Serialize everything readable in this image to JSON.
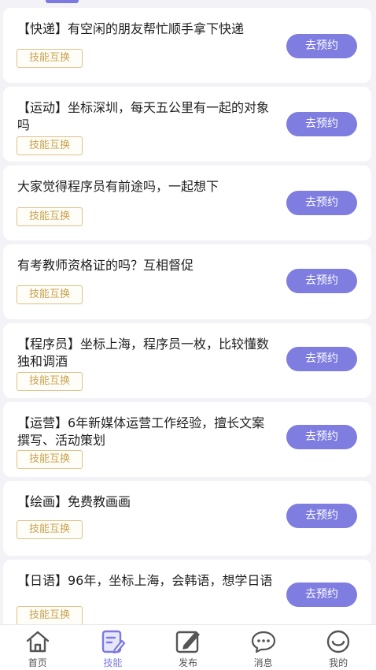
{
  "cards": [
    {
      "title": "【快递】有空闲的朋友帮忙顺手拿下快递",
      "tag": "技能互换",
      "button": "去预约"
    },
    {
      "title": "【运动】坐标深圳，每天五公里有一起的对象吗",
      "tag": "技能互换",
      "button": "去预约"
    },
    {
      "title": "大家觉得程序员有前途吗，一起想下",
      "tag": "技能互换",
      "button": "去预约"
    },
    {
      "title": "有考教师资格证的吗？互相督促",
      "tag": "技能互换",
      "button": "去预约"
    },
    {
      "title": "【程序员】坐标上海，程序员一枚，比较懂数独和调酒",
      "tag": "技能互换",
      "button": "去预约"
    },
    {
      "title": "【运营】6年新媒体运营工作经验，擅长文案撰写、活动策划",
      "tag": "技能互换",
      "button": "去预约"
    },
    {
      "title": "【绘画】免费教画画",
      "tag": "技能互换",
      "button": "去预约"
    },
    {
      "title": "【日语】96年，坐标上海，会韩语，想学日语",
      "tag": "技能互换",
      "button": "去预约"
    }
  ],
  "tabbar": {
    "items": [
      {
        "label": "首页",
        "icon": "home-icon"
      },
      {
        "label": "技能",
        "icon": "skill-edit-icon"
      },
      {
        "label": "发布",
        "icon": "publish-icon"
      },
      {
        "label": "消息",
        "icon": "message-icon"
      },
      {
        "label": "我的",
        "icon": "profile-icon"
      }
    ],
    "active_index": 1,
    "active_color": "#7c79df",
    "inactive_color": "#555555"
  },
  "colors": {
    "button": "#7f7de0",
    "tag_border": "#dcc28a",
    "tag_text": "#c9a24e",
    "background": "#f3f2f7"
  }
}
